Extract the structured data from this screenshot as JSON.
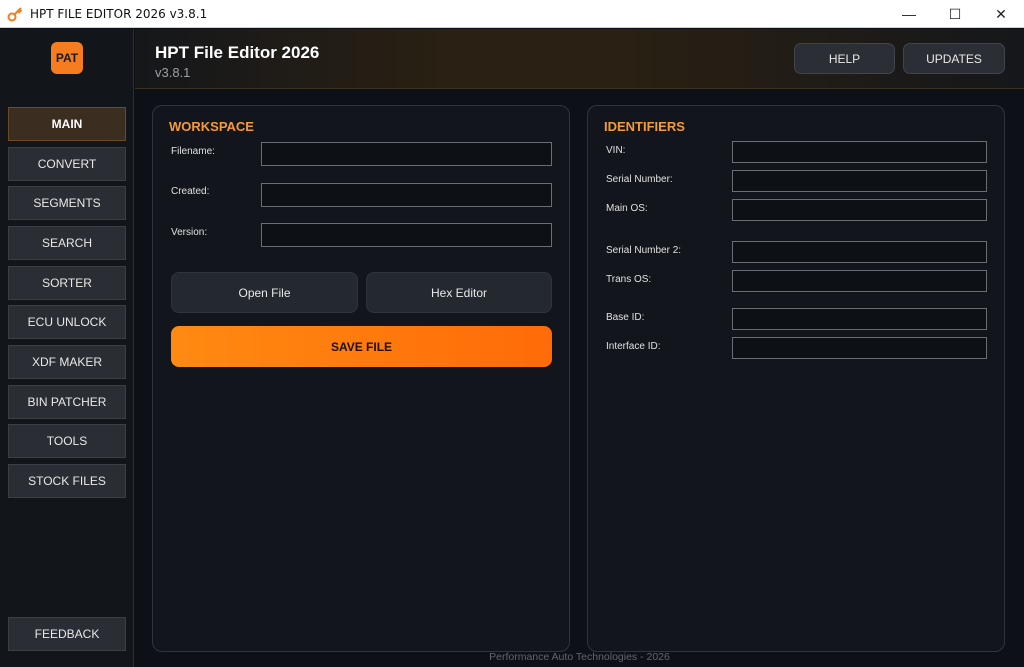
{
  "window": {
    "title": "HPT FILE EDITOR 2026 v3.8.1",
    "controls": {
      "minimize": "—",
      "maximize": "☐",
      "close": "✕"
    }
  },
  "sidebar": {
    "logo_text": "PAT",
    "items": [
      {
        "label": "MAIN",
        "active": true
      },
      {
        "label": "CONVERT"
      },
      {
        "label": "SEGMENTS"
      },
      {
        "label": "SEARCH"
      },
      {
        "label": "SORTER"
      },
      {
        "label": "ECU UNLOCK"
      },
      {
        "label": "XDF MAKER"
      },
      {
        "label": "BIN PATCHER"
      },
      {
        "label": "TOOLS"
      },
      {
        "label": "STOCK FILES"
      }
    ],
    "feedback_label": "FEEDBACK"
  },
  "header": {
    "title": "HPT File Editor 2026",
    "version": "v3.8.1",
    "help_label": "HELP",
    "updates_label": "UPDATES"
  },
  "workspace": {
    "title": "WORKSPACE",
    "fields": [
      {
        "label": "Filename:",
        "value": ""
      },
      {
        "label": "Created:",
        "value": ""
      },
      {
        "label": "Version:",
        "value": ""
      }
    ],
    "open_file_label": "Open File",
    "hex_editor_label": "Hex Editor",
    "save_file_label": "SAVE FILE"
  },
  "identifiers": {
    "title": "IDENTIFIERS",
    "fields": [
      {
        "label": "VIN:",
        "value": ""
      },
      {
        "label": "Serial Number:",
        "value": ""
      },
      {
        "label": "Main OS:",
        "value": ""
      },
      {
        "label": "Serial Number 2:",
        "value": ""
      },
      {
        "label": "Trans OS:",
        "value": ""
      },
      {
        "label": "Base ID:",
        "value": ""
      },
      {
        "label": "Interface ID:",
        "value": ""
      }
    ]
  },
  "footer": {
    "text": "Performance Auto Technologies - 2026"
  },
  "colors": {
    "accent": "#f57c1f",
    "title_orange": "#f59a3a",
    "save_gradient_start": "#ff8a12",
    "save_gradient_end": "#ff6b08"
  }
}
